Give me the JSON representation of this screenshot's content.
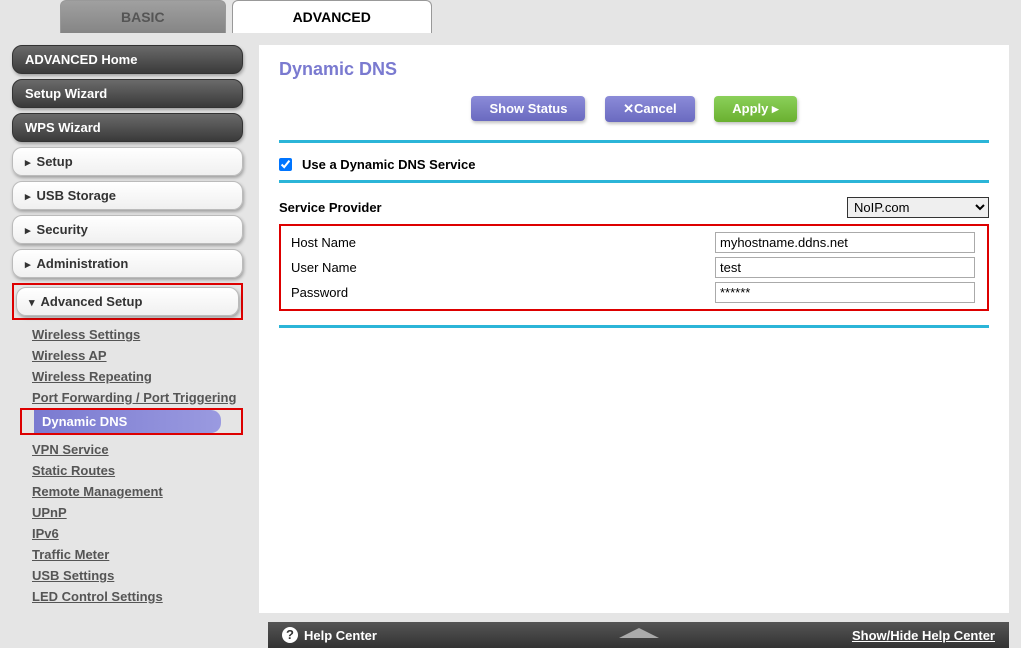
{
  "tabs": {
    "basic": "BASIC",
    "advanced": "ADVANCED"
  },
  "sidebar": {
    "home": "ADVANCED Home",
    "setup_wizard": "Setup Wizard",
    "wps_wizard": "WPS Wizard",
    "setup": "Setup",
    "usb": "USB Storage",
    "security": "Security",
    "admin": "Administration",
    "adv_setup": "Advanced Setup",
    "items": [
      "Wireless Settings",
      "Wireless AP",
      "Wireless Repeating",
      "Port Forwarding / Port Triggering",
      "Dynamic DNS",
      "VPN Service",
      "Static Routes",
      "Remote Management",
      "UPnP",
      "IPv6",
      "Traffic Meter",
      "USB Settings",
      "LED Control Settings"
    ]
  },
  "page": {
    "title": "Dynamic DNS",
    "show_status": "Show Status",
    "cancel": "✕Cancel",
    "apply": "Apply ▸",
    "use_ddns": "Use a Dynamic DNS Service",
    "use_ddns_checked": true,
    "provider_label": "Service Provider",
    "provider_value": "NoIP.com",
    "host_label": "Host Name",
    "host_value": "myhostname.ddns.net",
    "user_label": "User Name",
    "user_value": "test",
    "pass_label": "Password",
    "pass_value": "******"
  },
  "help": {
    "center": "Help Center",
    "toggle": "Show/Hide Help Center"
  }
}
